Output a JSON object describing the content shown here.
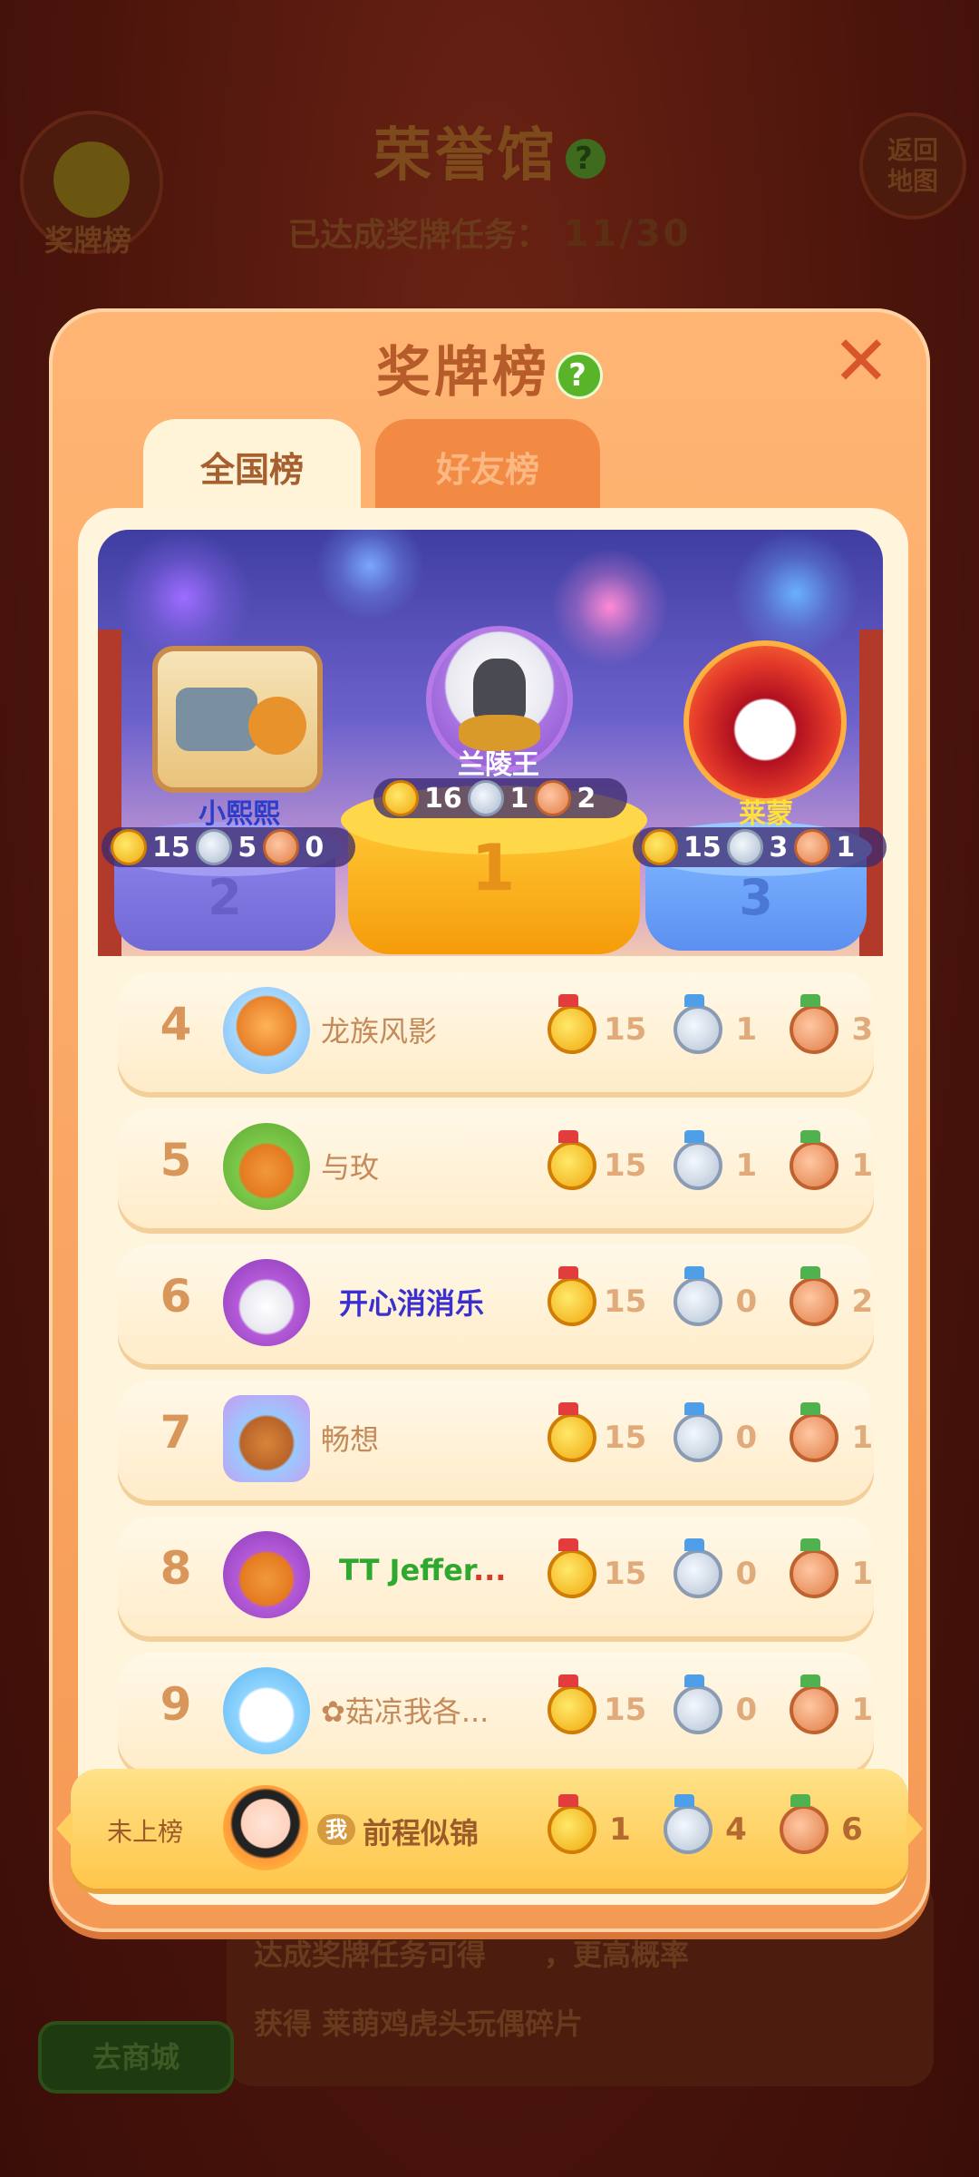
{
  "background": {
    "title": "荣誉馆",
    "help_glyph": "?",
    "progress_label": "已达成奖牌任务：",
    "progress_value": "11/30",
    "medal_board_button": "奖牌榜",
    "return_button": "返回地图",
    "return_line1": "返回",
    "return_line2": "地图",
    "shop_button": "去商城",
    "bottom_text_1": "达成奖牌任务可得",
    "bottom_text_1b": "，更高概率",
    "bottom_text_2": "获得",
    "bottom_text_2b": "莱萌鸡虎头玩偶碎片"
  },
  "modal": {
    "title": "奖牌榜",
    "help_glyph": "?",
    "close_glyph": "✕",
    "tabs": [
      {
        "label": "全国榜",
        "active": true
      },
      {
        "label": "好友榜",
        "active": false
      }
    ]
  },
  "podium": [
    {
      "rank": "1",
      "name": "兰陵王",
      "gold": "16",
      "silver": "1",
      "bronze": "2"
    },
    {
      "rank": "2",
      "name": "小熙熙",
      "gold": "15",
      "silver": "5",
      "bronze": "0"
    },
    {
      "rank": "3",
      "name": "莱蒙",
      "gold": "15",
      "silver": "3",
      "bronze": "1"
    }
  ],
  "rows": [
    {
      "rank": "4",
      "name": "龙族风影",
      "gold": "15",
      "silver": "1",
      "bronze": "3",
      "color": "#c48a5a"
    },
    {
      "rank": "5",
      "name": "与玫",
      "gold": "15",
      "silver": "1",
      "bronze": "1",
      "color": "#c48a5a"
    },
    {
      "rank": "6",
      "name": "开心消消乐",
      "gold": "15",
      "silver": "0",
      "bronze": "2",
      "color": "#3a2fd0"
    },
    {
      "rank": "7",
      "name": "畅想",
      "gold": "15",
      "silver": "0",
      "bronze": "1",
      "color": "#c48a5a"
    },
    {
      "rank": "8",
      "name": "TT Jeffer...",
      "gold": "15",
      "silver": "0",
      "bronze": "1",
      "color": "#2fa82f"
    },
    {
      "rank": "9",
      "name": "✿菇凉我各...",
      "gold": "15",
      "silver": "0",
      "bronze": "1",
      "color": "#c48a5a"
    }
  ],
  "me": {
    "rank_label": "未上榜",
    "tag": "我",
    "name": "前程似锦",
    "gold": "1",
    "silver": "4",
    "bronze": "6"
  },
  "colors": {
    "modal_bg": "#f59a55",
    "content_bg": "#fff5dc",
    "gold": "#f0a80e",
    "silver": "#aab9cc",
    "bronze": "#e07d46",
    "accent_green": "#59b42a"
  }
}
